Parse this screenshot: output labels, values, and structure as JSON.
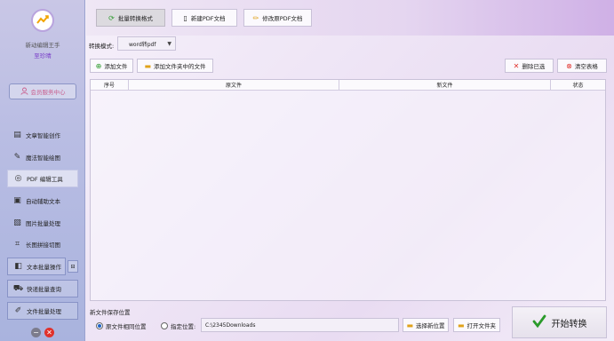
{
  "app": {
    "name": "新动编辑王手",
    "promo": "至珍晴"
  },
  "sidebar": {
    "member": "会员服务中心",
    "items": [
      {
        "label": "文章智能创作",
        "icon": "document-edit-icon"
      },
      {
        "label": "魔法智能绘图",
        "icon": "magic-wand-icon"
      },
      {
        "label": "PDF 编辑工具",
        "icon": "pdf-icon"
      },
      {
        "label": "自动辅助文本",
        "icon": "text-auto-icon"
      },
      {
        "label": "图片批量处理",
        "icon": "image-icon"
      },
      {
        "label": "长图拼接切图",
        "icon": "crop-icon"
      },
      {
        "label": "文本批量操作",
        "icon": "text-batch-icon"
      },
      {
        "label": "快递批量查询",
        "icon": "truck-icon"
      },
      {
        "label": "文件批量处理",
        "icon": "file-edit-icon"
      }
    ],
    "mini_label": "⊟"
  },
  "tabs": [
    {
      "label": "批量转换格式"
    },
    {
      "label": "新建PDF文档"
    },
    {
      "label": "修改原PDF文档"
    }
  ],
  "mode": {
    "label": "转换模式:",
    "value": "word转pdf"
  },
  "toolbar": {
    "add_file": "添加文件",
    "add_folder": "添加文件夹中的文件",
    "delete_selected": "删除已选",
    "clear_table": "清空表格"
  },
  "table": {
    "columns": [
      "序号",
      "原文件",
      "新文件",
      "状态"
    ],
    "rows": []
  },
  "save": {
    "title": "新文件保存位置",
    "option_same": "原文件相同位置",
    "option_custom": "指定位置:",
    "path": "C:\\2345Downloads",
    "choose": "选择新位置",
    "open_folder": "打开文件夹"
  },
  "start_label": "开始转换",
  "colors": {
    "accent": "#7a3fc9",
    "sidebar": "#b9bde3",
    "delete": "#e0312b",
    "start_check": "#2a9a2a"
  }
}
